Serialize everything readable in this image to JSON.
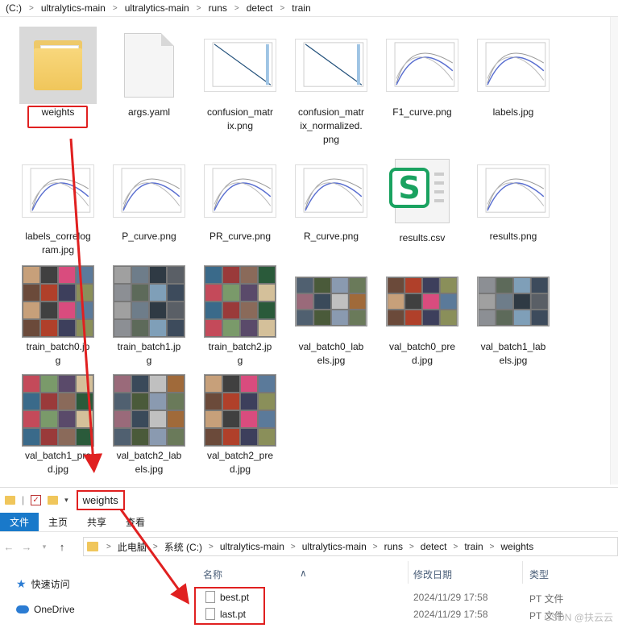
{
  "top_window": {
    "breadcrumb": [
      "(C:)",
      "ultralytics-main",
      "ultralytics-main",
      "runs",
      "detect",
      "train"
    ],
    "files": [
      {
        "name": "weights",
        "kind": "folder"
      },
      {
        "name": "args.yaml",
        "kind": "doc"
      },
      {
        "name": "confusion_matrix.png",
        "kind": "chart"
      },
      {
        "name": "confusion_matrix_normalized.png",
        "kind": "chart"
      },
      {
        "name": "F1_curve.png",
        "kind": "chart"
      },
      {
        "name": "labels.jpg",
        "kind": "chart"
      },
      {
        "name": "labels_correlogram.jpg",
        "kind": "chart"
      },
      {
        "name": "P_curve.png",
        "kind": "chart"
      },
      {
        "name": "PR_curve.png",
        "kind": "chart"
      },
      {
        "name": "R_curve.png",
        "kind": "chart"
      },
      {
        "name": "results.csv",
        "kind": "csv"
      },
      {
        "name": "results.png",
        "kind": "chart"
      },
      {
        "name": "train_batch0.jpg",
        "kind": "photo"
      },
      {
        "name": "train_batch1.jpg",
        "kind": "photo"
      },
      {
        "name": "train_batch2.jpg",
        "kind": "photo"
      },
      {
        "name": "val_batch0_labels.jpg",
        "kind": "photo"
      },
      {
        "name": "val_batch0_pred.jpg",
        "kind": "photo"
      },
      {
        "name": "val_batch1_labels.jpg",
        "kind": "photo"
      },
      {
        "name": "val_batch1_pred.jpg",
        "kind": "photo"
      },
      {
        "name": "val_batch2_labels.jpg",
        "kind": "photo"
      },
      {
        "name": "val_batch2_pred.jpg",
        "kind": "photo"
      }
    ]
  },
  "bottom_window": {
    "title": "weights",
    "ribbon_tabs": [
      "文件",
      "主页",
      "共享",
      "查看"
    ],
    "breadcrumb": [
      "此电脑",
      "系统 (C:)",
      "ultralytics-main",
      "ultralytics-main",
      "runs",
      "detect",
      "train",
      "weights"
    ],
    "nav_items": [
      "快速访问",
      "OneDrive"
    ],
    "columns": {
      "name": "名称",
      "modified": "修改日期",
      "type": "类型"
    },
    "rows": [
      {
        "name": "best.pt",
        "modified": "2024/11/29 17:58",
        "type": "PT 文件"
      },
      {
        "name": "last.pt",
        "modified": "2024/11/29 17:58",
        "type": "PT 文件"
      }
    ]
  },
  "watermark": "CSDN @扶云云",
  "colors": {
    "highlight": "#e02020",
    "accent": "#1979ca",
    "folder": "#f0c65b"
  }
}
